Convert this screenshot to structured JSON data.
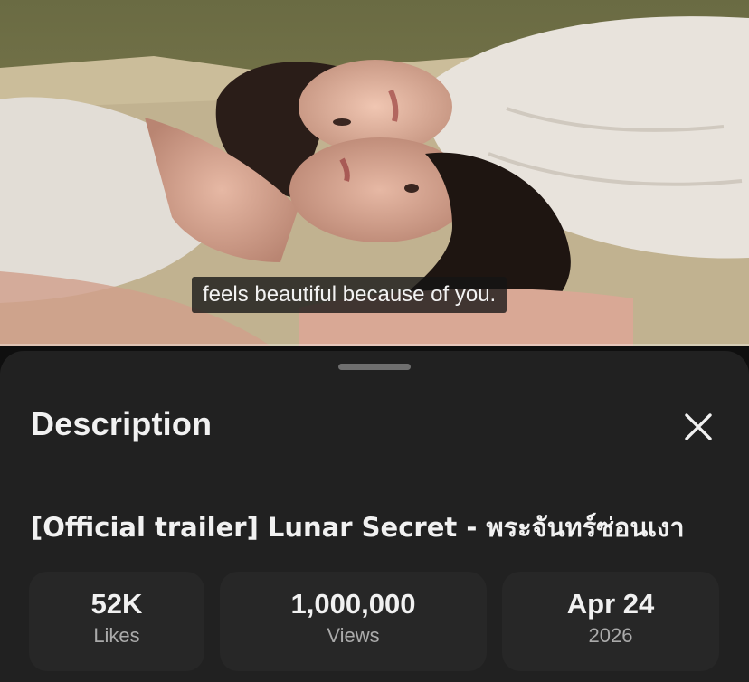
{
  "video": {
    "subtitle": "feels beautiful because of you."
  },
  "sheet": {
    "title": "Description",
    "close_icon": "close-icon",
    "video_title": "[Official trailer] Lunar Secret - พระจันทร์ซ่อนเงา",
    "stats": [
      {
        "value": "52K",
        "label": "Likes"
      },
      {
        "value": "1,000,000",
        "label": "Views"
      },
      {
        "value": "Apr 24",
        "label": "2026"
      }
    ]
  },
  "colors": {
    "sheet_bg": "#212121",
    "stat_bg": "#272727",
    "primary_text": "#f1f1f1",
    "secondary_text": "#aaaaaa"
  }
}
